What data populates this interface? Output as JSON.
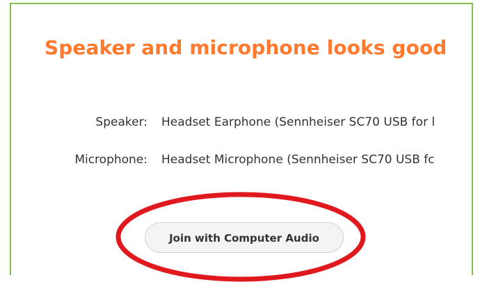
{
  "dialog": {
    "title": "Speaker and microphone looks good",
    "speaker": {
      "label": "Speaker:",
      "value": "Headset Earphone (Sennheiser SC70 USB for l"
    },
    "microphone": {
      "label": "Microphone:",
      "value": "Headset Microphone (Sennheiser SC70 USB fc"
    },
    "join_button_label": "Join with Computer Audio"
  },
  "colors": {
    "title": "#ff7a2f",
    "panel_border": "#7fbf4a",
    "highlight_annotation": "#e0191f"
  }
}
